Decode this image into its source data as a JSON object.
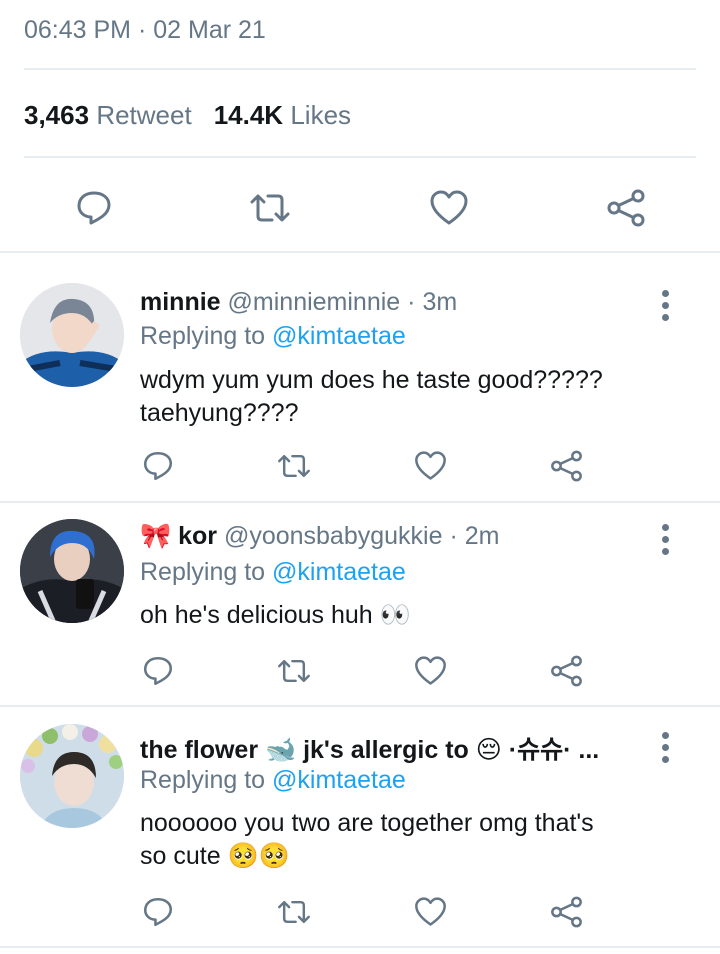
{
  "tweet": {
    "time": "06:43 PM",
    "separator": "·",
    "date": "02 Mar 21",
    "retweet_count": "3,463",
    "retweet_label": "Retweet",
    "likes_count": "14.4K",
    "likes_label": "Likes"
  },
  "replies": [
    {
      "display_name": "minnie",
      "handle": "@minnieminnie",
      "time": "3m",
      "replying_prefix": "Replying to",
      "replying_to": "@kimtaetae",
      "text": "wdym yum yum does he taste good?????\ntaehyung????"
    },
    {
      "display_name": "🎀 kor",
      "handle": "@yoonsbabygukkie",
      "time": "2m",
      "replying_prefix": "Replying to",
      "replying_to": "@kimtaetae",
      "text": "oh he's delicious huh 👀"
    },
    {
      "display_name": "the flower 🐋 jk's allergic to 😔 ·슈슈· ...",
      "handle": "",
      "time": "",
      "replying_prefix": "Replying to",
      "replying_to": "@kimtaetae",
      "text": "noooooo you two are together omg that's\nso cute 🥺🥺"
    }
  ],
  "icons": {
    "reply": "reply-bubble-icon",
    "retweet": "retweet-icon",
    "like": "heart-icon",
    "share": "share-icon",
    "more": "more-vertical-icon"
  },
  "colors": {
    "text": "#14171a",
    "secondary": "#657786",
    "link": "#1da1f2",
    "divider": "#e6ecf0"
  }
}
